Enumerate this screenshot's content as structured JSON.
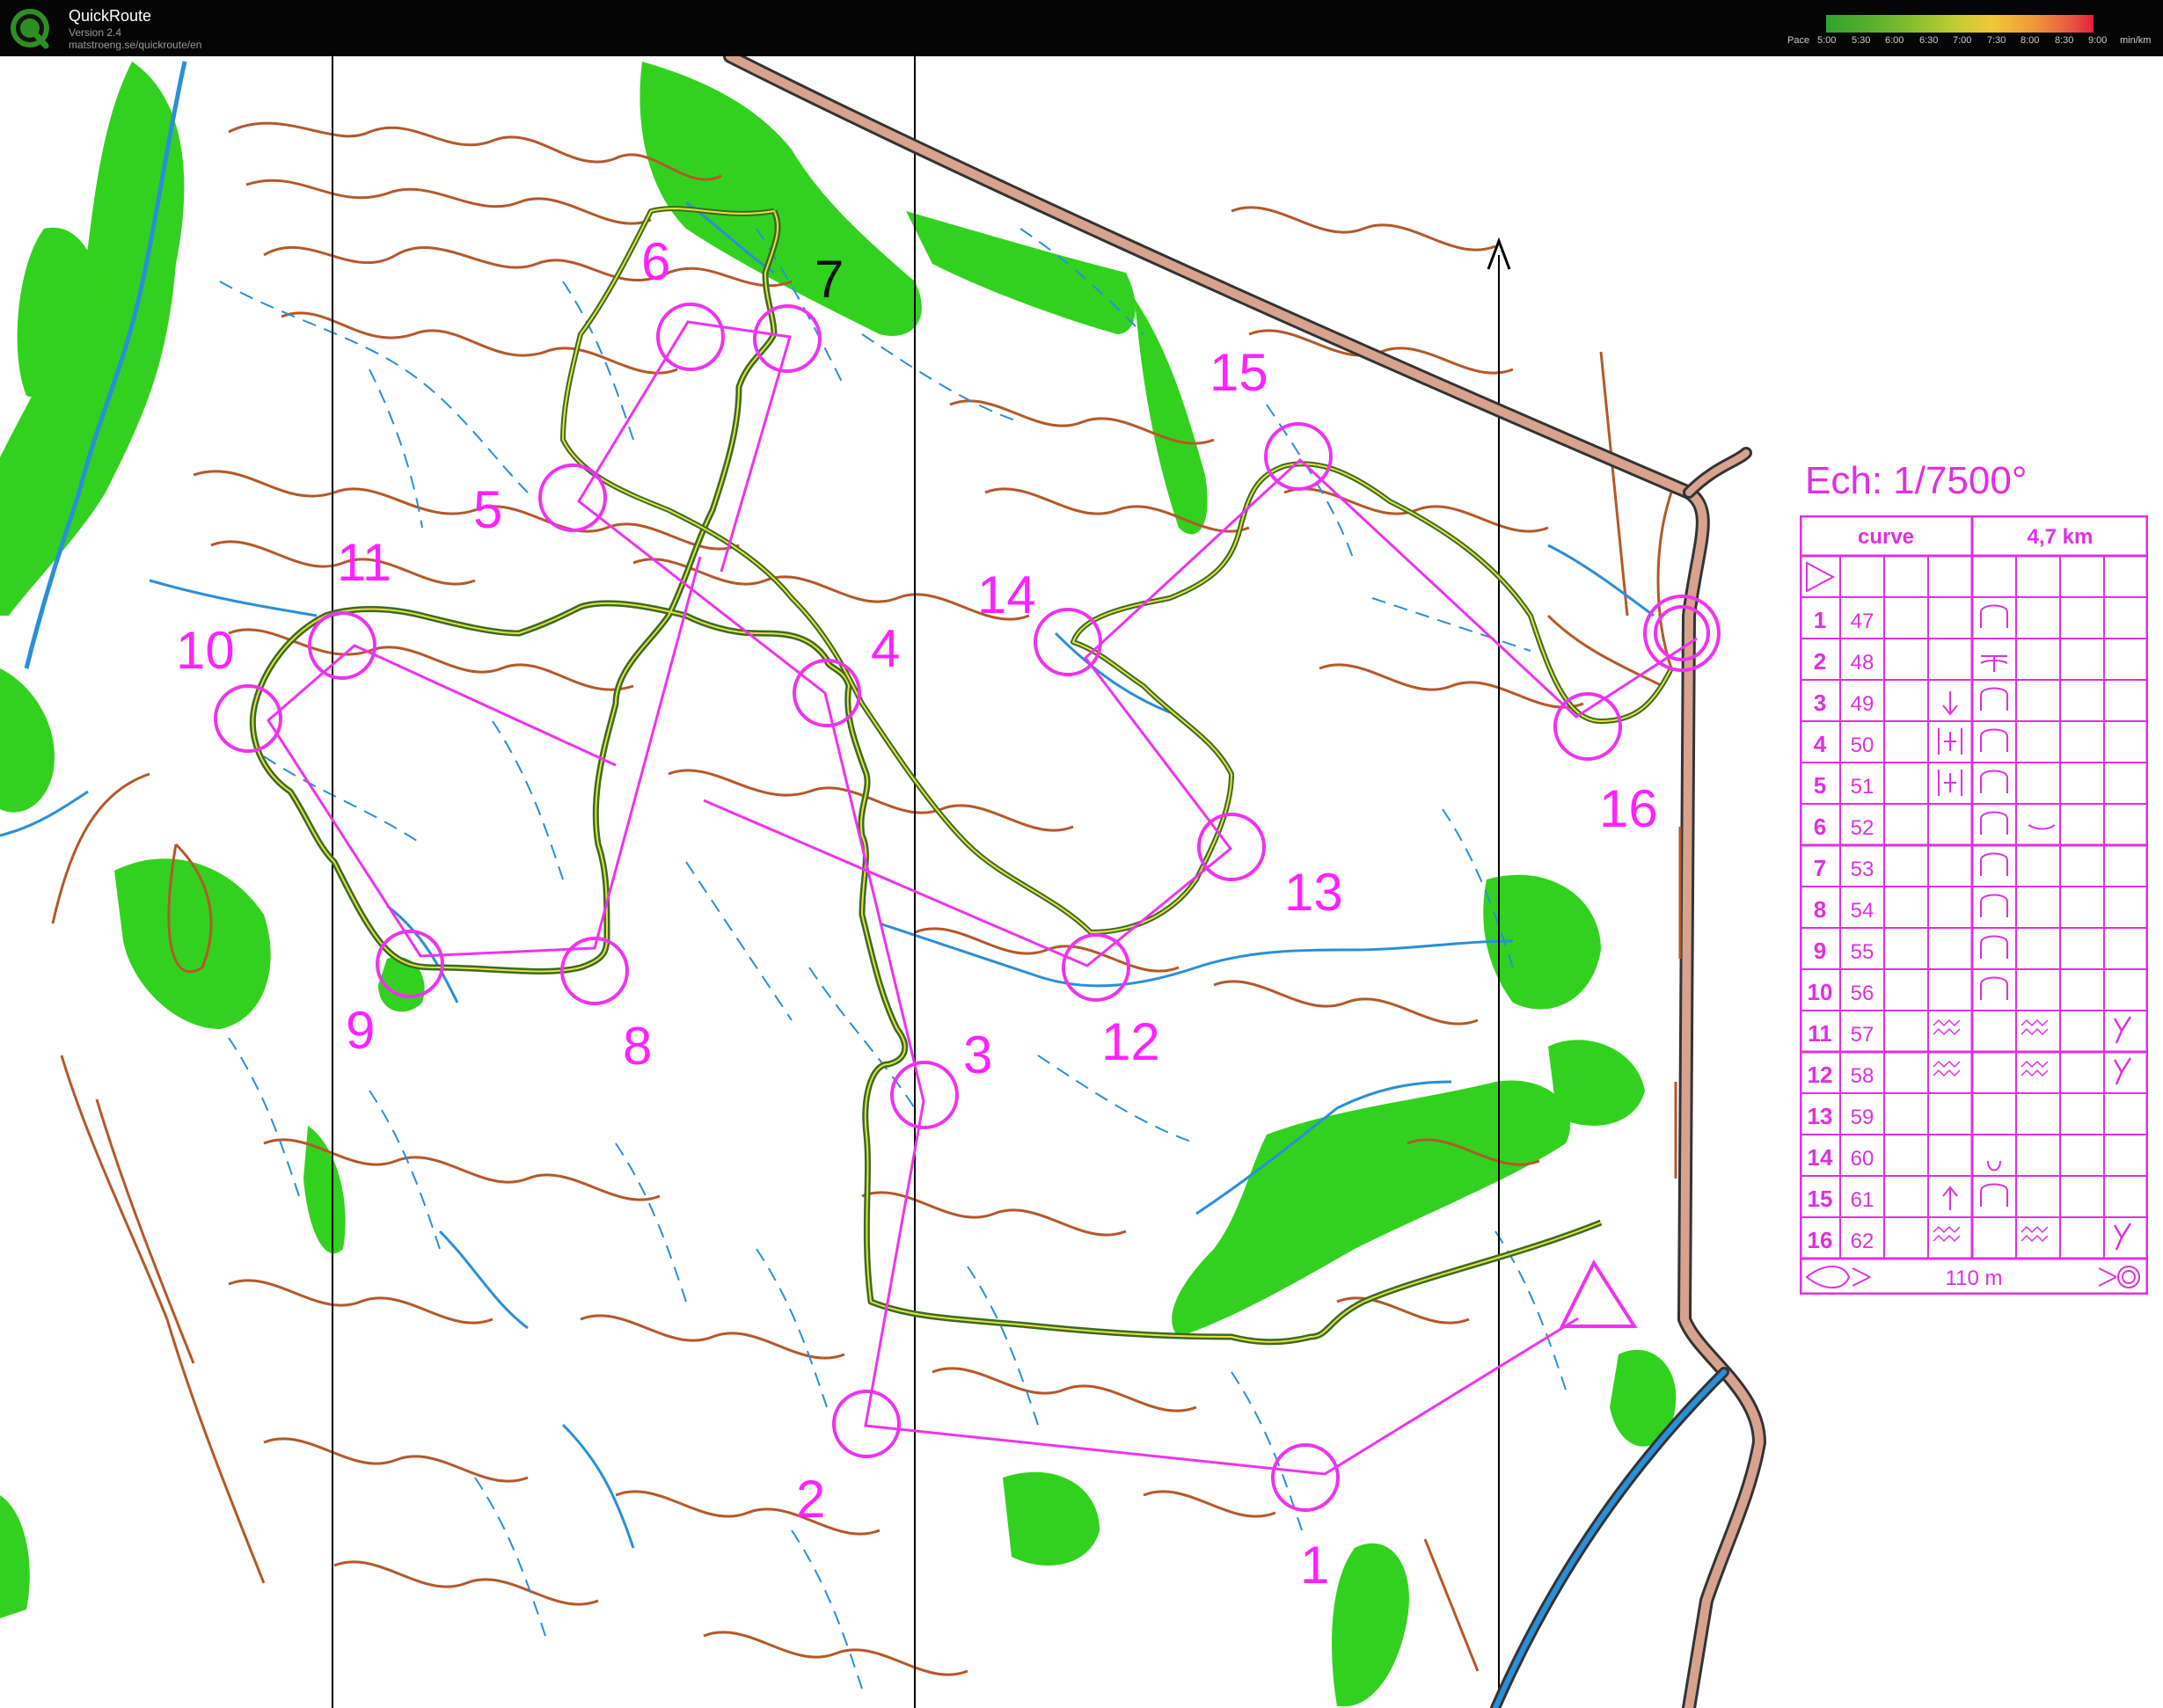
{
  "window": {
    "app_name": "QuickRoute",
    "version": "Version 2.4",
    "url": "matstroeng.se/quickroute/en"
  },
  "pace_legend": {
    "label": "Pace",
    "ticks": [
      "5:00",
      "5:30",
      "6:00",
      "6:30",
      "7:00",
      "7:30",
      "8:00",
      "8:30",
      "9:00"
    ],
    "unit": "min/km",
    "colors": [
      "#2fa32b",
      "#8fc12e",
      "#c6cc34",
      "#f0c838",
      "#f0963a",
      "#e85540",
      "#e0203c"
    ]
  },
  "map": {
    "controls": [
      {
        "label": "1"
      },
      {
        "label": "2"
      },
      {
        "label": "3"
      },
      {
        "label": "4"
      },
      {
        "label": "5"
      },
      {
        "label": "6"
      },
      {
        "label": "7"
      },
      {
        "label": "8"
      },
      {
        "label": "9"
      },
      {
        "label": "10"
      },
      {
        "label": "11"
      },
      {
        "label": "12"
      },
      {
        "label": "13"
      },
      {
        "label": "14"
      },
      {
        "label": "15"
      },
      {
        "label": "16"
      }
    ],
    "course_color": "#ee33ee",
    "route_color": "#3c6e24",
    "vegetation_color": "#33d11f",
    "contour_color": "#b4582a",
    "water_color": "#2a8fd8",
    "road_color": "#d7a38e"
  },
  "description": {
    "title": "Ech: 1/7500°",
    "class": "curve",
    "length": "4,7 km",
    "controls": [
      {
        "num": "1",
        "code": "47"
      },
      {
        "num": "2",
        "code": "48"
      },
      {
        "num": "3",
        "code": "49"
      },
      {
        "num": "4",
        "code": "50"
      },
      {
        "num": "5",
        "code": "51"
      },
      {
        "num": "6",
        "code": "52"
      },
      {
        "num": "7",
        "code": "53"
      },
      {
        "num": "8",
        "code": "54"
      },
      {
        "num": "9",
        "code": "55"
      },
      {
        "num": "10",
        "code": "56"
      },
      {
        "num": "11",
        "code": "57"
      },
      {
        "num": "12",
        "code": "58"
      },
      {
        "num": "13",
        "code": "59"
      },
      {
        "num": "14",
        "code": "60"
      },
      {
        "num": "15",
        "code": "61"
      },
      {
        "num": "16",
        "code": "62"
      }
    ],
    "finish_distance": "110 m"
  }
}
